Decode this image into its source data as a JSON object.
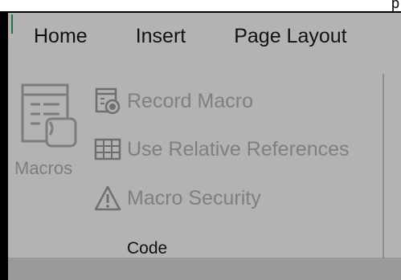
{
  "corner_text": "p",
  "tabs": [
    {
      "label": "Home"
    },
    {
      "label": "Insert"
    },
    {
      "label": "Page Layout"
    }
  ],
  "code_group": {
    "macros_label": "Macros",
    "commands": [
      {
        "label": "Record Macro",
        "icon": "record-macro-icon"
      },
      {
        "label": "Use Relative References",
        "icon": "relative-references-grid-icon"
      },
      {
        "label": "Macro Security",
        "icon": "warning-triangle-icon"
      }
    ],
    "group_label": "Code"
  },
  "colors": {
    "ribbon_bg": "#b3b3b3",
    "disabled_text": "#7f7f7f",
    "frame": "#000000"
  }
}
